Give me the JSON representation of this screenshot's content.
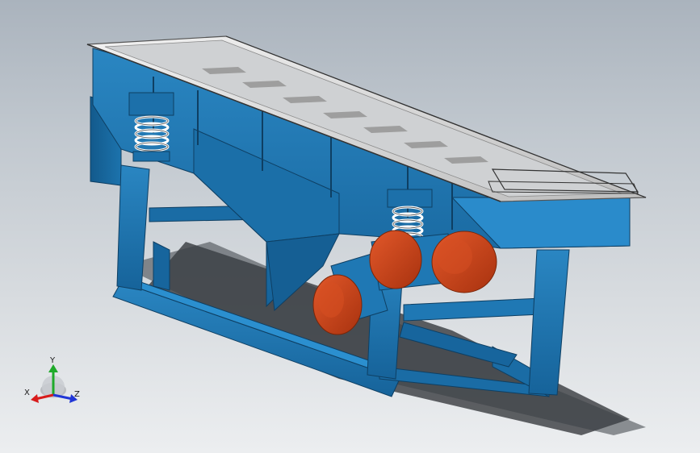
{
  "viewport": {
    "background_top": "#aab3bd",
    "background_bottom": "#eceef0"
  },
  "model": {
    "frame_color": "#1f78b4",
    "motor_color": "#c8441c",
    "spring_color": "#ffffff",
    "deck_color": "#d8d8d8"
  },
  "triad": {
    "x_label": "X",
    "y_label": "Y",
    "z_label": "Z",
    "x_color": "#d81b1b",
    "y_color": "#1faa2a",
    "z_color": "#2036d6"
  }
}
